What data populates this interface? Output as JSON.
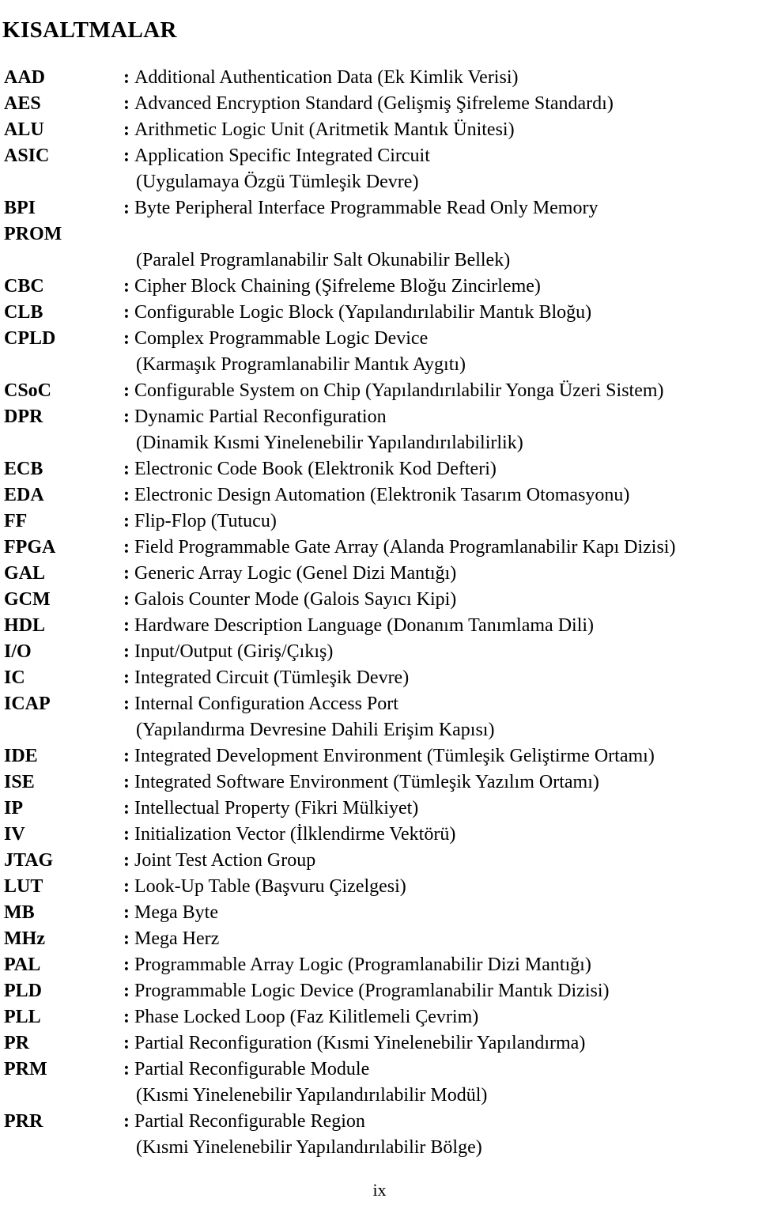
{
  "document": {
    "title": "KISALTMALAR",
    "page_number": "ix",
    "colon": ":"
  },
  "entries": [
    {
      "term": "AAD",
      "definition": "Additional Authentication Data (Ek Kimlik Verisi)"
    },
    {
      "term": "AES",
      "definition": "Advanced Encryption Standard (Gelişmiş Şifreleme Standardı)"
    },
    {
      "term": "ALU",
      "definition": "Arithmetic Logic Unit (Aritmetik Mantık Ünitesi)"
    },
    {
      "term": "ASIC",
      "definition": "Application Specific Integrated Circuit",
      "continuation": "(Uygulamaya Özgü Tümleşik Devre)"
    },
    {
      "term": "BPI",
      "definition": "Byte Peripheral Interface Programmable Read Only Memory",
      "term_second_line": "PROM",
      "continuation": "(Paralel Programlanabilir Salt Okunabilir Bellek)"
    },
    {
      "term": "CBC",
      "definition": "Cipher Block Chaining (Şifreleme Bloğu Zincirleme)"
    },
    {
      "term": "CLB",
      "definition": "Configurable Logic Block (Yapılandırılabilir Mantık Bloğu)"
    },
    {
      "term": "CPLD",
      "definition": "Complex Programmable Logic Device",
      "continuation": "(Karmaşık Programlanabilir Mantık Aygıtı)"
    },
    {
      "term": "CSoC",
      "definition": "Configurable System on Chip (Yapılandırılabilir Yonga Üzeri Sistem)"
    },
    {
      "term": "DPR",
      "definition": "Dynamic Partial Reconfiguration",
      "continuation": "(Dinamik Kısmi Yinelenebilir Yapılandırılabilirlik)"
    },
    {
      "term": "ECB",
      "definition": "Electronic Code Book (Elektronik Kod Defteri)"
    },
    {
      "term": "EDA",
      "definition": "Electronic Design Automation (Elektronik Tasarım Otomasyonu)"
    },
    {
      "term": "FF",
      "definition": "Flip-Flop (Tutucu)"
    },
    {
      "term": "FPGA",
      "definition": "Field Programmable Gate Array (Alanda Programlanabilir Kapı Dizisi)"
    },
    {
      "term": "GAL",
      "definition": "Generic Array Logic (Genel Dizi Mantığı)"
    },
    {
      "term": "GCM",
      "definition": "Galois Counter Mode (Galois Sayıcı Kipi)"
    },
    {
      "term": "HDL",
      "definition": "Hardware Description Language (Donanım Tanımlama Dili)"
    },
    {
      "term": "I/O",
      "definition": "Input/Output (Giriş/Çıkış)"
    },
    {
      "term": "IC",
      "definition": "Integrated Circuit (Tümleşik Devre)"
    },
    {
      "term": "ICAP",
      "definition": "Internal Configuration Access Port",
      "continuation": "(Yapılandırma Devresine Dahili Erişim Kapısı)"
    },
    {
      "term": "IDE",
      "definition": "Integrated Development Environment (Tümleşik Geliştirme Ortamı)"
    },
    {
      "term": "ISE",
      "definition": "Integrated Software Environment (Tümleşik Yazılım Ortamı)"
    },
    {
      "term": "IP",
      "definition": "Intellectual Property (Fikri Mülkiyet)"
    },
    {
      "term": "IV",
      "definition": "Initialization Vector (İlklendirme Vektörü)"
    },
    {
      "term": "JTAG",
      "definition": "Joint Test Action Group"
    },
    {
      "term": "LUT",
      "definition": "Look-Up Table (Başvuru Çizelgesi)"
    },
    {
      "term": "MB",
      "definition": "Mega Byte"
    },
    {
      "term": "MHz",
      "definition": "Mega Herz"
    },
    {
      "term": "PAL",
      "definition": "Programmable Array Logic (Programlanabilir Dizi Mantığı)"
    },
    {
      "term": "PLD",
      "definition": "Programmable Logic Device (Programlanabilir Mantık Dizisi)"
    },
    {
      "term": "PLL",
      "definition": "Phase Locked Loop (Faz Kilitlemeli Çevrim)"
    },
    {
      "term": "PR",
      "definition": "Partial Reconfiguration (Kısmi Yinelenebilir Yapılandırma)"
    },
    {
      "term": "PRM",
      "definition": "Partial Reconfigurable Module",
      "continuation": "(Kısmi Yinelenebilir Yapılandırılabilir Modül)"
    },
    {
      "term": "PRR",
      "definition": "Partial Reconfigurable Region",
      "continuation": "(Kısmi Yinelenebilir Yapılandırılabilir Bölge)"
    }
  ]
}
